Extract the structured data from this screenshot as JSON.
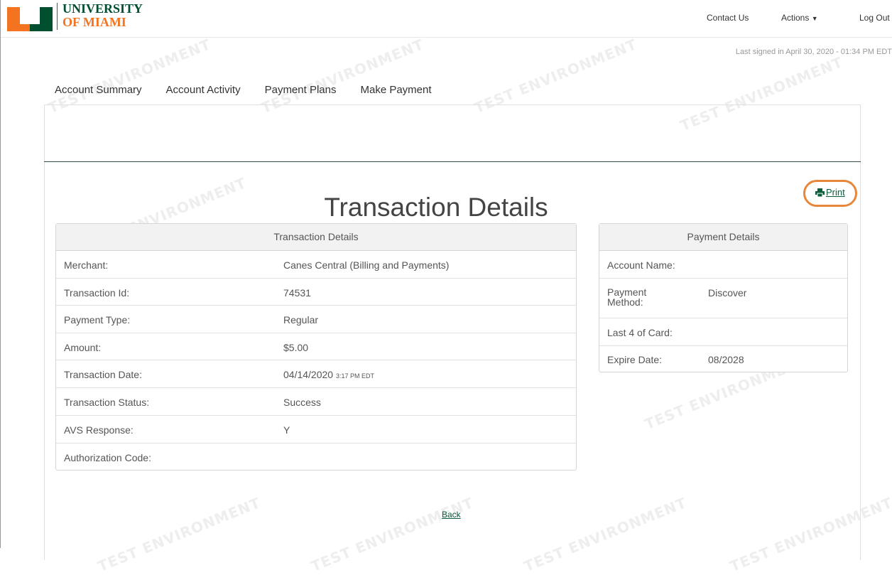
{
  "header": {
    "logo": {
      "line1": "UNIVERSITY",
      "line2": "OF MIAMI"
    },
    "nav": {
      "contact": "Contact Us",
      "actions": "Actions",
      "logout": "Log Out"
    },
    "last_signed": "Last signed in April 30, 2020 - 01:34 PM EDT"
  },
  "tabs": [
    "Account Summary",
    "Account Activity",
    "Payment Plans",
    "Make Payment"
  ],
  "watermark": "TEST ENVIRONMENT",
  "page_title": "Transaction Details",
  "print_label": "Print",
  "transaction": {
    "heading": "Transaction Details",
    "rows": [
      {
        "label": "Merchant:",
        "value": "Canes Central (Billing and Payments)"
      },
      {
        "label": "Transaction Id:",
        "value": "74531"
      },
      {
        "label": "Payment Type:",
        "value": "Regular"
      },
      {
        "label": "Amount:",
        "value": "$5.00"
      },
      {
        "label": "Transaction Date:",
        "value": "04/14/2020",
        "value_small": "3:17 PM EDT"
      },
      {
        "label": "Transaction Status:",
        "value": "Success"
      },
      {
        "label": "AVS Response:",
        "value": "Y"
      },
      {
        "label": "Authorization Code:",
        "value": ""
      }
    ]
  },
  "payment": {
    "heading": "Payment Details",
    "rows": [
      {
        "label": "Account Name:",
        "value": ""
      },
      {
        "label": "Payment Method:",
        "value": "Discover"
      },
      {
        "label": "Last 4 of Card:",
        "value": ""
      },
      {
        "label": "Expire Date:",
        "value": "08/2028"
      }
    ]
  },
  "back_label": "Back",
  "colors": {
    "brand_green": "#005030",
    "brand_orange": "#f47321",
    "link": "#0b5d3b",
    "highlight": "#e8873a"
  }
}
